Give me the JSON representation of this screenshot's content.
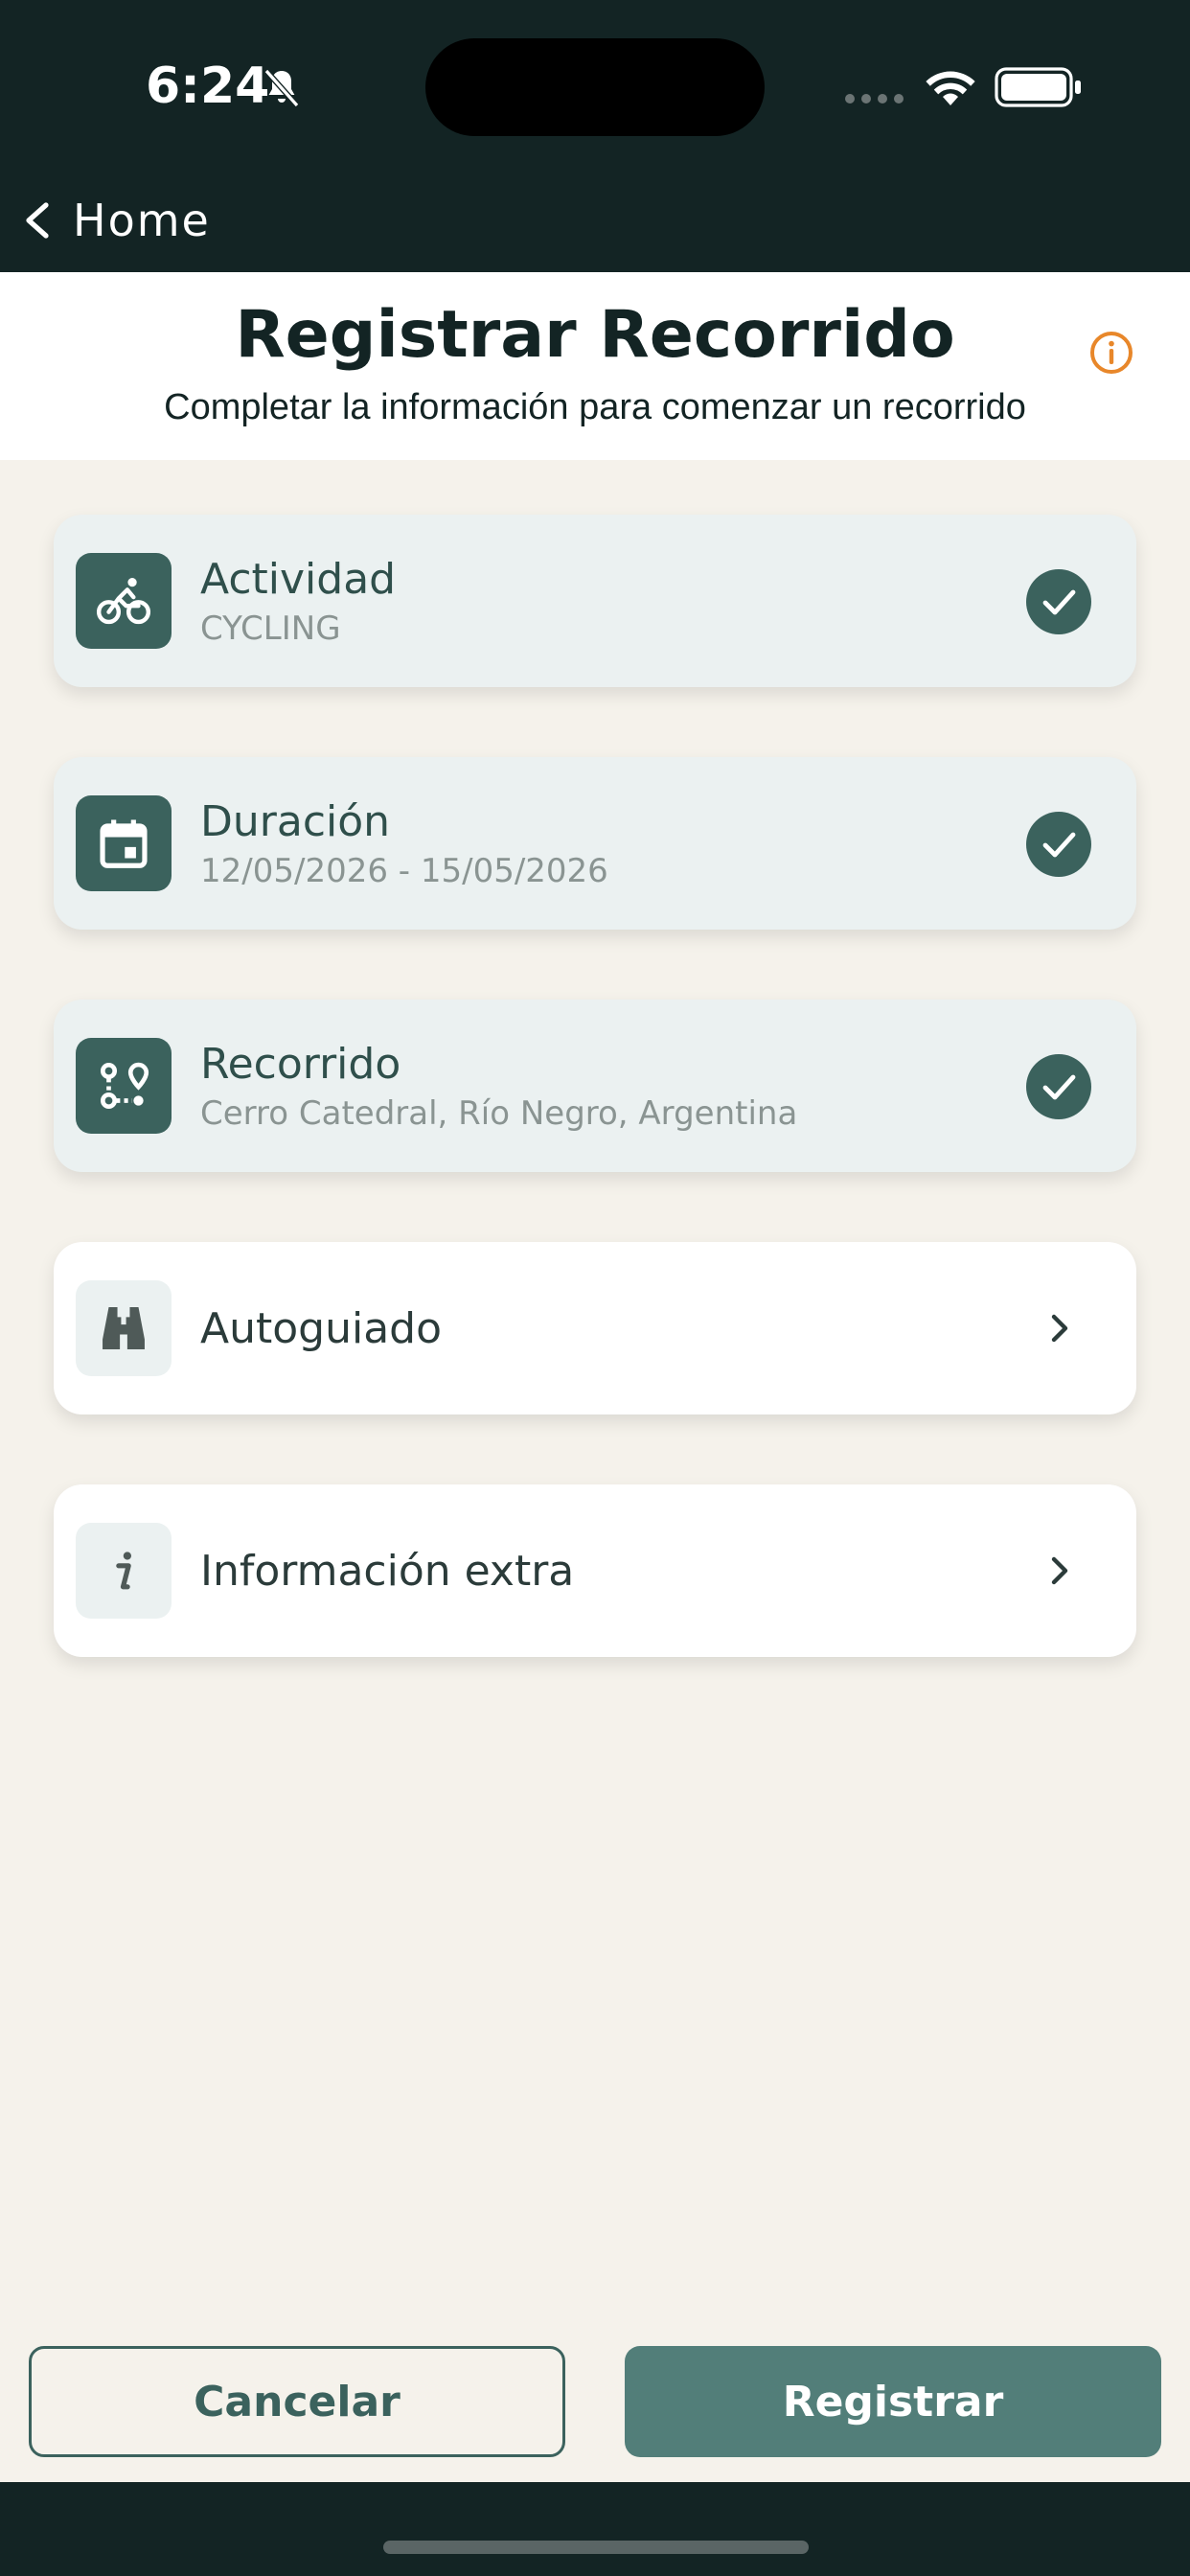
{
  "status_bar": {
    "time": "6:24"
  },
  "nav": {
    "back_label": "Home"
  },
  "header": {
    "title": "Registrar Recorrido",
    "subtitle": "Completar la información para comenzar un recorrido"
  },
  "cards": [
    {
      "title": "Actividad",
      "subtitle": "CYCLING",
      "icon": "bicycle-icon",
      "status": "complete"
    },
    {
      "title": "Duración",
      "subtitle": "12/05/2026 - 15/05/2026",
      "icon": "calendar-icon",
      "status": "complete"
    },
    {
      "title": "Recorrido",
      "subtitle": "Cerro Catedral, Río Negro, Argentina",
      "icon": "route-icon",
      "status": "complete"
    },
    {
      "title": "Autoguiado",
      "icon": "binoculars-icon",
      "status": "pending"
    },
    {
      "title": "Información extra",
      "icon": "info-italic-icon",
      "status": "pending"
    }
  ],
  "buttons": {
    "cancel_label": "Cancelar",
    "register_label": "Registrar"
  },
  "colors": {
    "dark_bg": "#132424",
    "accent": "#3b625d",
    "primary_button": "#527e79",
    "info_icon": "#e8872a",
    "page_bg": "#f5f2eb"
  }
}
